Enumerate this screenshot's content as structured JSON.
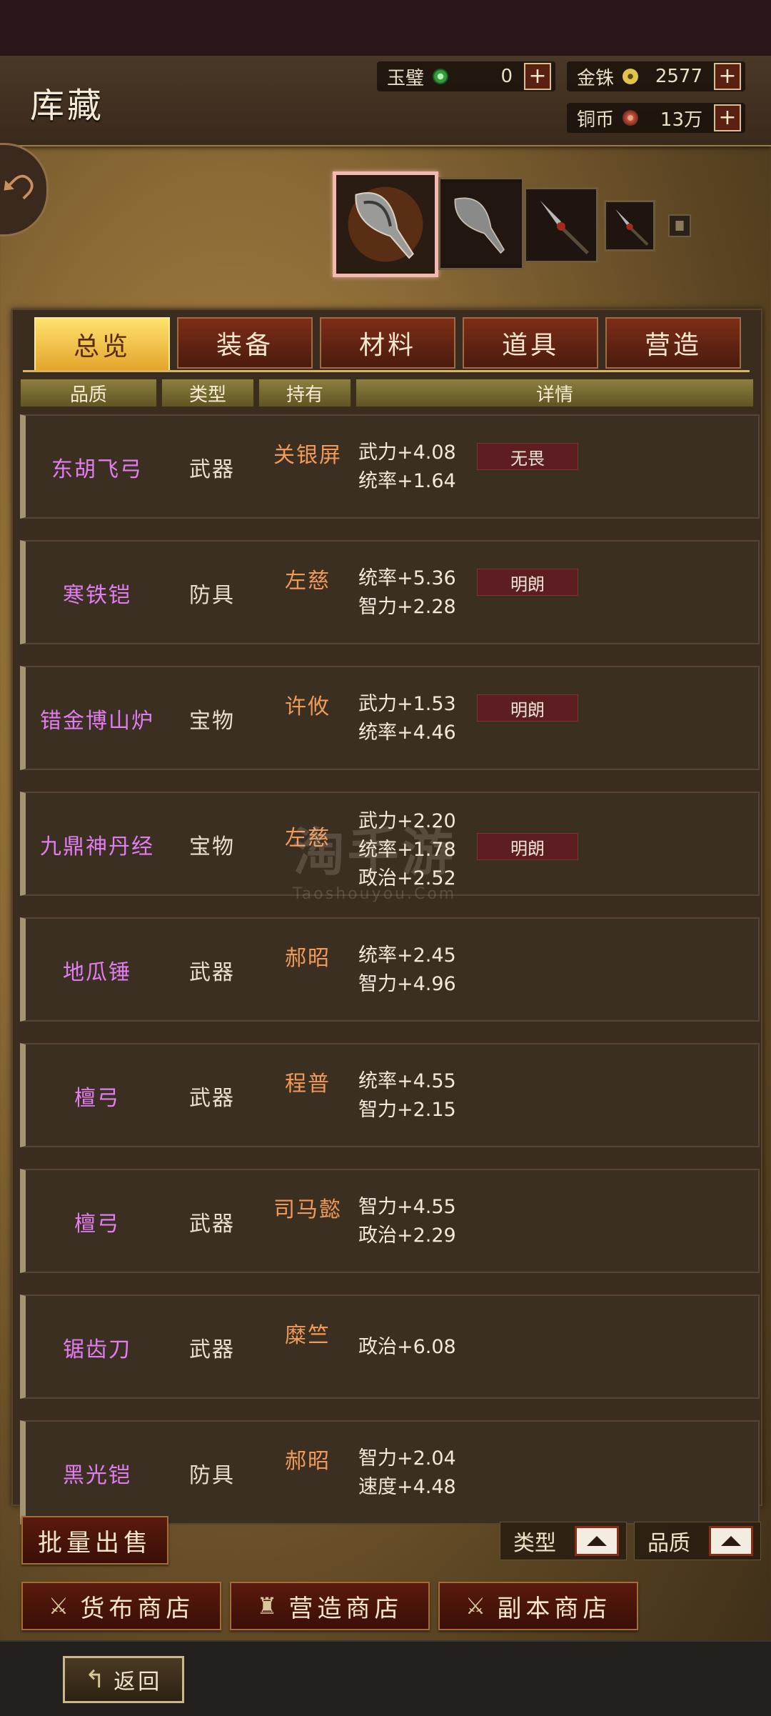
{
  "header": {
    "title": "库藏",
    "currencies": [
      {
        "label": "玉璧",
        "value": "0",
        "icon": "jade-icon",
        "color": "#3bb54a"
      },
      {
        "label": "金铢",
        "value": "2577",
        "icon": "gold-coin-icon",
        "color": "#e3c44a"
      },
      {
        "label": "铜币",
        "value": "13万",
        "icon": "copper-coin-icon",
        "color": "#c2553f"
      }
    ],
    "plus": "+"
  },
  "tabs": [
    "总览",
    "装备",
    "材料",
    "道具",
    "营造"
  ],
  "active_tab": "总览",
  "columns": [
    "品质",
    "类型",
    "持有",
    "详情"
  ],
  "rows": [
    {
      "name": "东胡飞弓",
      "type": "武器",
      "holder": "关银屏",
      "stats": [
        "武力+4.08",
        "统率+1.64"
      ],
      "badge": "无畏"
    },
    {
      "name": "寒铁铠",
      "type": "防具",
      "holder": "左慈",
      "stats": [
        "统率+5.36",
        "智力+2.28"
      ],
      "badge": "明朗"
    },
    {
      "name": "错金博山炉",
      "type": "宝物",
      "holder": "许攸",
      "stats": [
        "武力+1.53",
        "统率+4.46"
      ],
      "badge": "明朗"
    },
    {
      "name": "九鼎神丹经",
      "type": "宝物",
      "holder": "左慈",
      "stats": [
        "武力+2.20",
        "统率+1.78",
        "政治+2.52"
      ],
      "badge": "明朗"
    },
    {
      "name": "地瓜锤",
      "type": "武器",
      "holder": "郝昭",
      "stats": [
        "统率+2.45",
        "智力+4.96"
      ],
      "badge": ""
    },
    {
      "name": "檀弓",
      "type": "武器",
      "holder": "程普",
      "stats": [
        "统率+4.55",
        "智力+2.15"
      ],
      "badge": ""
    },
    {
      "name": "檀弓",
      "type": "武器",
      "holder": "司马懿",
      "stats": [
        "智力+4.55",
        "政治+2.29"
      ],
      "badge": ""
    },
    {
      "name": "锯齿刀",
      "type": "武器",
      "holder": "糜竺",
      "stats": [
        "政治+6.08"
      ],
      "badge": ""
    },
    {
      "name": "黑光铠",
      "type": "防具",
      "holder": "郝昭",
      "stats": [
        "智力+2.04",
        "速度+4.48"
      ],
      "badge": ""
    }
  ],
  "bottom": {
    "bulk_sell": "批量出售",
    "sort_type": "类型",
    "sort_quality": "品质",
    "shops": [
      "货布商店",
      "营造商店",
      "副本商店"
    ],
    "back": "返回"
  },
  "watermark": {
    "main": "淘手游",
    "sub": "Taoshouyou.Com"
  }
}
